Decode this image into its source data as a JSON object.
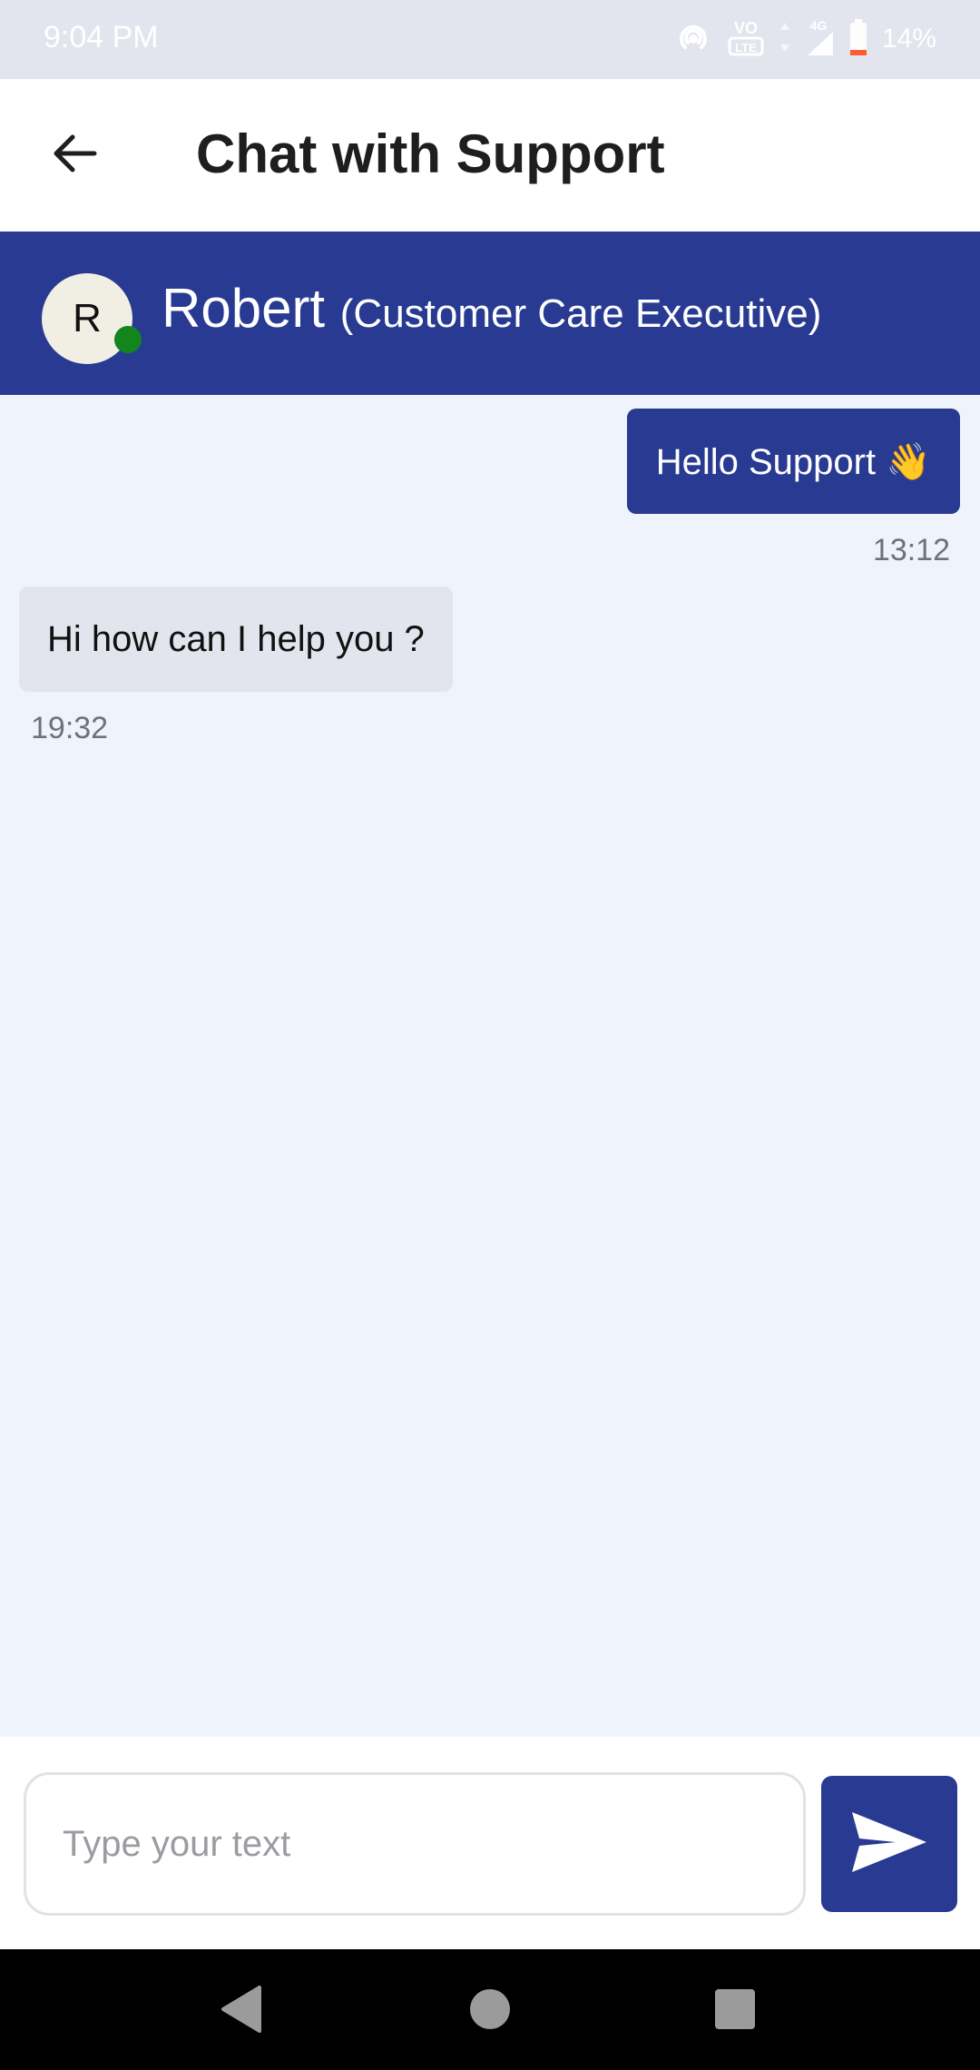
{
  "status_bar": {
    "time": "9:04 PM",
    "battery_percent": "14%",
    "network_label": "4G",
    "volte_label": "VoLTE",
    "icons": [
      "hotspot-icon",
      "volte-icon",
      "data-arrows-icon",
      "signal-icon",
      "battery-icon"
    ],
    "battery_level": 0.14,
    "battery_low_color": "#ff5b2e"
  },
  "app_bar": {
    "title": "Chat with Support",
    "back_icon": "arrow-left-icon"
  },
  "agent": {
    "avatar_initial": "R",
    "name": "Robert",
    "role": "(Customer Care Executive)",
    "online": true,
    "online_color": "#12861c"
  },
  "messages": [
    {
      "direction": "outgoing",
      "text": "Hello Support 👋",
      "time": "13:12"
    },
    {
      "direction": "incoming",
      "text": "Hi how can I help you ?",
      "time": "19:32"
    }
  ],
  "composer": {
    "value": "",
    "placeholder": "Type your text",
    "send_icon": "send-icon"
  },
  "nav_bar": {
    "icons": [
      "back-triangle-icon",
      "home-circle-icon",
      "recents-square-icon"
    ]
  },
  "colors": {
    "primary": "#283a92",
    "background": "#eef3fc",
    "incoming_bubble": "#e2e5ee",
    "status_bar": "#e3e5ee"
  }
}
